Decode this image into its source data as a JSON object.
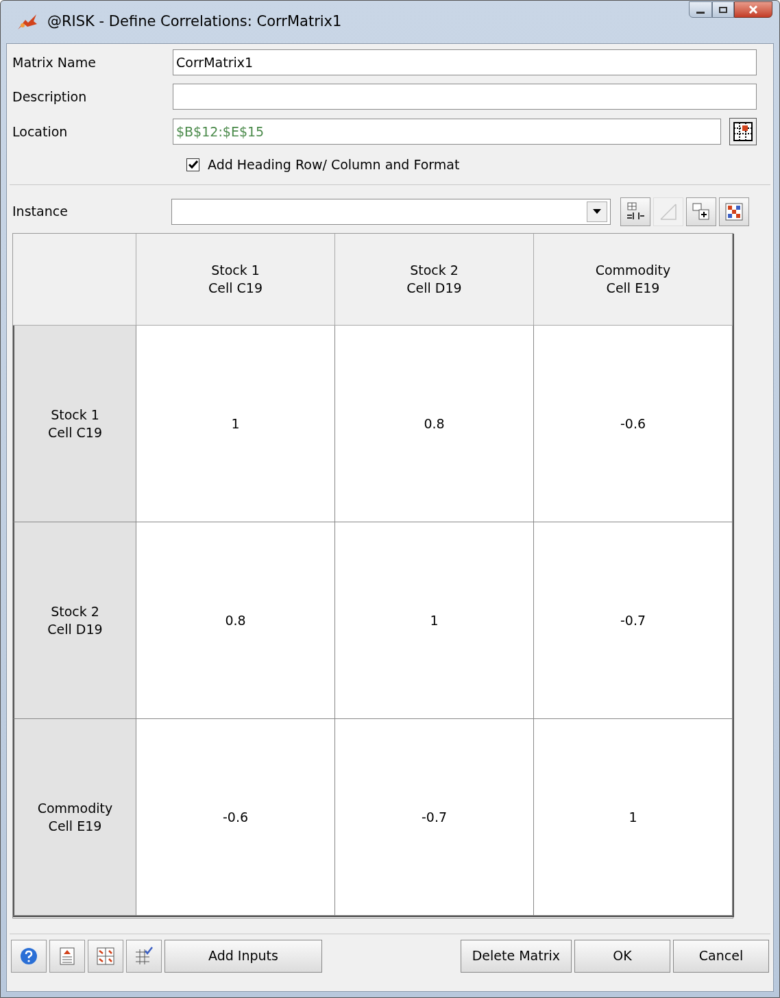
{
  "window": {
    "title": "@RISK - Define Correlations: CorrMatrix1"
  },
  "fields": [
    {
      "label": "Matrix Name",
      "value": "CorrMatrix1",
      "kind": "text"
    },
    {
      "label": "Description",
      "kind": "text"
    },
    {
      "label": "Location",
      "value": "$B$12:$E$15",
      "kind": "range"
    }
  ],
  "heading_option": {
    "label": "Add Heading Row/ Column and Format",
    "checked": true
  },
  "instance": {
    "label": "Instance"
  },
  "instance_tools": [
    {
      "disabled": false
    },
    {
      "disabled": true
    },
    {
      "disabled": false
    },
    {
      "disabled": false
    }
  ],
  "matrix": {
    "columns": [
      {
        "title": "Stock 1",
        "cell": "Cell C19"
      },
      {
        "title": "Stock 2",
        "cell": "Cell D19"
      },
      {
        "title": "Commodity",
        "cell": "Cell E19"
      }
    ],
    "rows": [
      {
        "title": "Stock 1",
        "cell": "Cell C19",
        "values": [
          "1",
          "0.8",
          "-0.6"
        ]
      },
      {
        "title": "Stock 2",
        "cell": "Cell D19",
        "values": [
          "0.8",
          "1",
          "-0.7"
        ]
      },
      {
        "title": "Commodity",
        "cell": "Cell E19",
        "values": [
          "-0.6",
          "-0.7",
          "1"
        ]
      }
    ]
  },
  "left_buttons": [
    "Add Inputs"
  ],
  "right_buttons": [
    "Delete Matrix",
    "OK",
    "Cancel"
  ]
}
